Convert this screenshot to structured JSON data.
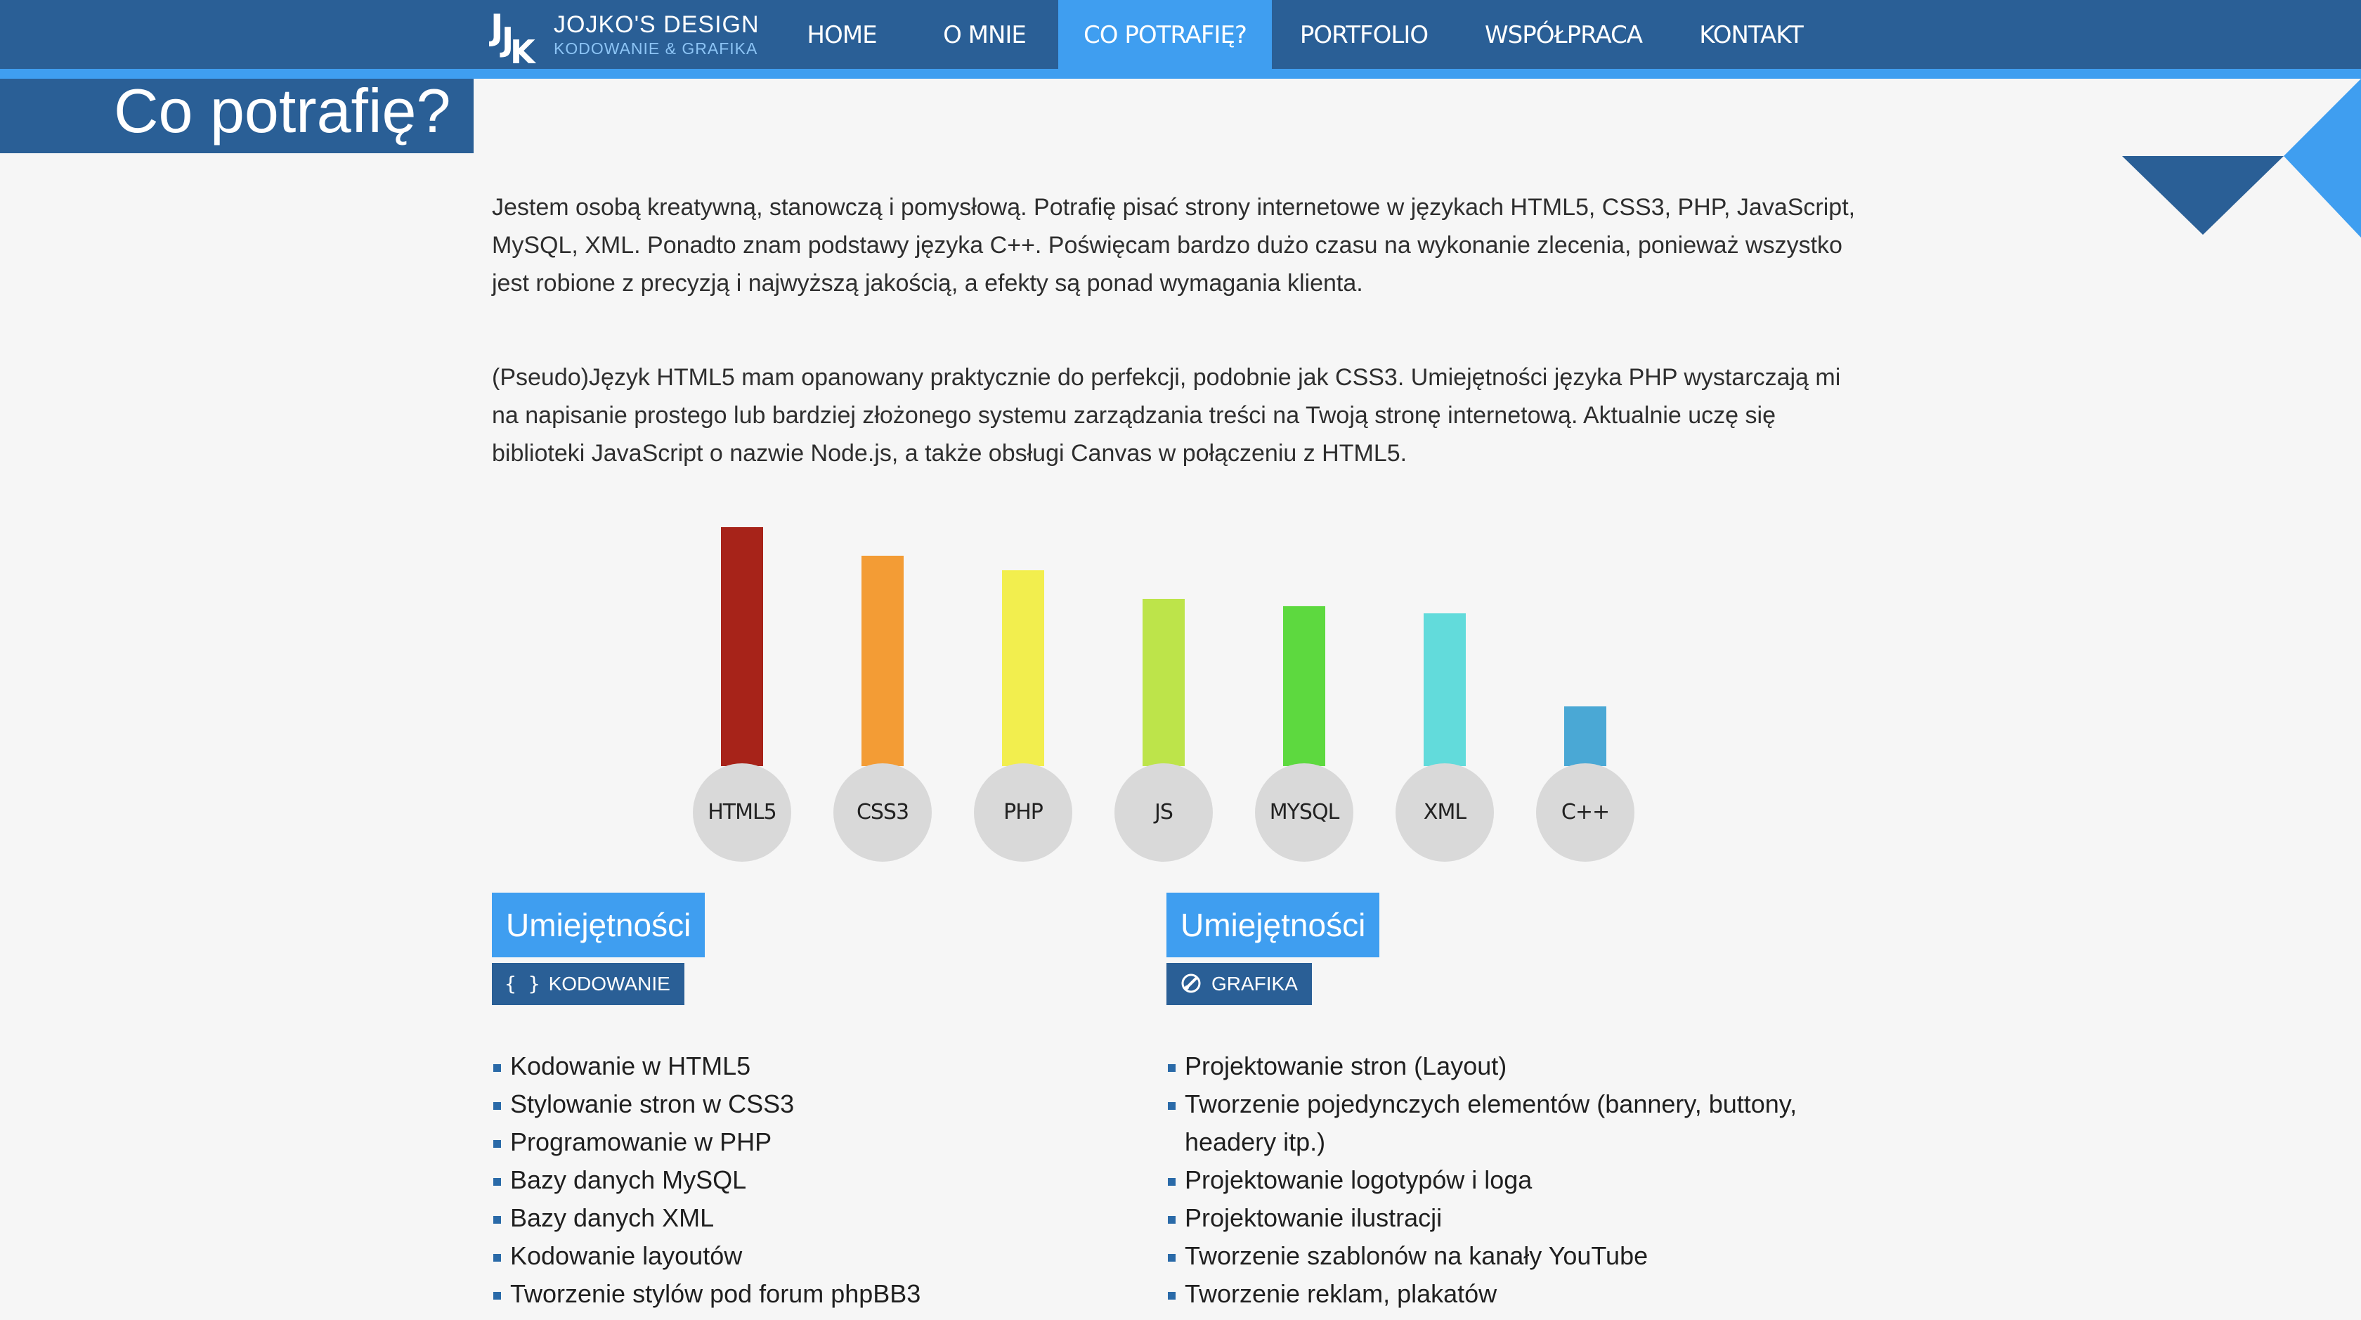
{
  "brand": {
    "title": "JOJKO'S DESIGN",
    "subtitle": "KODOWANIE & GRAFIKA",
    "colors": {
      "nav": "#2a5f96",
      "accent": "#3f9ef0",
      "background": "#f6f6f6"
    }
  },
  "nav": {
    "items": [
      {
        "label": "HOME"
      },
      {
        "label": "O MNIE"
      },
      {
        "label": "CO POTRAFIĘ?",
        "active": true
      },
      {
        "label": "PORTFOLIO"
      },
      {
        "label": "WSPÓŁPRACA"
      },
      {
        "label": "KONTAKT"
      }
    ]
  },
  "page": {
    "title": "Co potrafię?",
    "paragraphs": [
      "Jestem osobą kreatywną, stanowczą i pomysłową. Potrafię pisać strony internetowe w językach HTML5, CSS3, PHP, JavaScript, MySQL, XML. Ponadto znam podstawy języka C++. Poświęcam bardzo dużo czasu na wykonanie zlecenia, ponieważ wszystko jest robione z precyzją i najwyższą jakością, a efekty są ponad wymagania klienta.",
      "(Pseudo)Język HTML5 mam opanowany praktycznie do perfekcji, podobnie jak CSS3. Umiejętności języka PHP wystarczają mi na napisanie prostego lub bardziej złożonego systemu zarządzania treści na Twoją stronę internetową. Aktualnie uczę się biblioteki JavaScript o nazwie Node.js, a także obsługi Canvas w połączeniu z HTML5."
    ]
  },
  "chart_data": {
    "type": "bar",
    "categories": [
      "HTML5",
      "CSS3",
      "PHP",
      "JS",
      "MYSQL",
      "XML",
      "C++"
    ],
    "values": [
      100,
      88,
      82,
      70,
      67,
      64,
      25
    ],
    "colors": [
      "#a72319",
      "#f39c35",
      "#f2ee4e",
      "#bde44a",
      "#5dd93f",
      "#62dbdb",
      "#4aa8d5"
    ],
    "ylim": [
      0,
      100
    ],
    "grid": false,
    "title": "",
    "xlabel": "",
    "ylabel": ""
  },
  "skills": {
    "left": {
      "heading": "Umiejętności",
      "tag_icon": "{ }",
      "tag_label": "KODOWANIE",
      "items": [
        "Kodowanie w HTML5",
        "Stylowanie stron w CSS3",
        "Programowanie w PHP",
        "Bazy danych MySQL",
        "Bazy danych XML",
        "Kodowanie layoutów",
        "Tworzenie stylów pod forum phpBB3"
      ]
    },
    "right": {
      "heading": "Umiejętności",
      "tag_icon": "brush-icon",
      "tag_label": "GRAFIKA",
      "items": [
        "Projektowanie stron (Layout)",
        "Tworzenie pojedynczych elementów (bannery, buttony, headery itp.)",
        "Projektowanie logotypów i loga",
        "Projektowanie ilustracji",
        "Tworzenie szablonów na kanały YouTube",
        "Tworzenie reklam, plakatów"
      ]
    }
  }
}
